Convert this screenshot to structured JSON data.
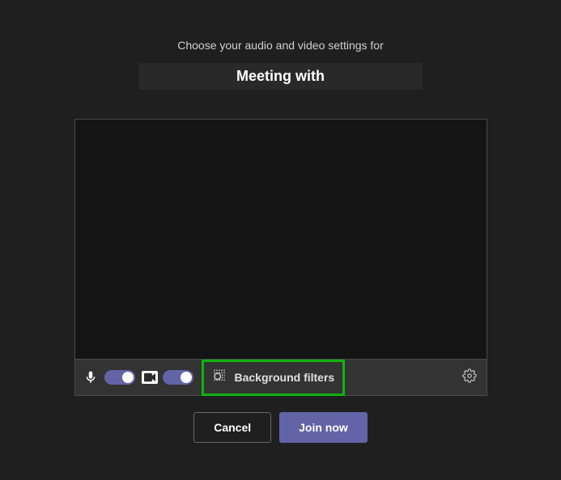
{
  "header": {
    "subtitle": "Choose your audio and video settings for"
  },
  "meeting": {
    "title": "Meeting with"
  },
  "controls": {
    "mic_on": true,
    "camera_on": true,
    "background_filters_label": "Background filters"
  },
  "buttons": {
    "cancel": "Cancel",
    "join": "Join now"
  },
  "colors": {
    "accent": "#6264a7",
    "highlight_border": "#0fb30f"
  }
}
